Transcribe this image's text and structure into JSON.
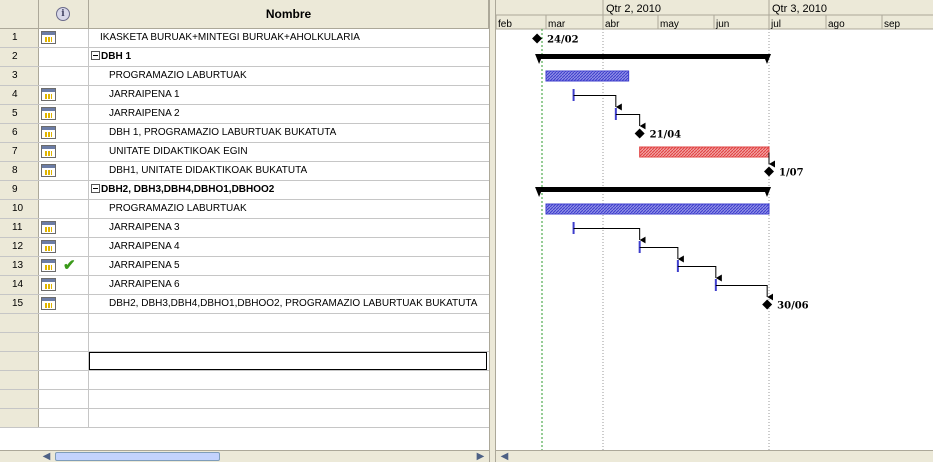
{
  "grid": {
    "header_name": "Nombre",
    "header_indicator_icon": "info-icon",
    "rows": [
      {
        "id": "1",
        "name": "IKASKETA BURUAK+MINTEGI BURUAK+AHOLKULARIA",
        "kind": "normal",
        "calendar_icon": true,
        "check_icon": false
      },
      {
        "id": "2",
        "name": "DBH 1",
        "kind": "summary",
        "calendar_icon": false,
        "check_icon": false
      },
      {
        "id": "3",
        "name": "PROGRAMAZIO LABURTUAK",
        "kind": "child",
        "calendar_icon": false,
        "check_icon": false
      },
      {
        "id": "4",
        "name": "JARRAIPENA 1",
        "kind": "child",
        "calendar_icon": true,
        "check_icon": false
      },
      {
        "id": "5",
        "name": "JARRAIPENA 2",
        "kind": "child",
        "calendar_icon": true,
        "check_icon": false
      },
      {
        "id": "6",
        "name": "DBH 1, PROGRAMAZIO LABURTUAK BUKATUTA",
        "kind": "child",
        "calendar_icon": true,
        "check_icon": false
      },
      {
        "id": "7",
        "name": "UNITATE DIDAKTIKOAK EGIN",
        "kind": "child",
        "calendar_icon": true,
        "check_icon": false
      },
      {
        "id": "8",
        "name": "DBH1, UNITATE DIDAKTIKOAK BUKATUTA",
        "kind": "child",
        "calendar_icon": true,
        "check_icon": false
      },
      {
        "id": "9",
        "name": "DBH2, DBH3,DBH4,DBHO1,DBHOO2",
        "kind": "summary",
        "calendar_icon": false,
        "check_icon": false
      },
      {
        "id": "10",
        "name": "PROGRAMAZIO LABURTUAK",
        "kind": "child",
        "calendar_icon": false,
        "check_icon": false
      },
      {
        "id": "11",
        "name": "JARRAIPENA 3",
        "kind": "child",
        "calendar_icon": true,
        "check_icon": false
      },
      {
        "id": "12",
        "name": "JARRAIPENA 4",
        "kind": "child",
        "calendar_icon": true,
        "check_icon": false
      },
      {
        "id": "13",
        "name": "JARRAIPENA 5",
        "kind": "child",
        "calendar_icon": true,
        "check_icon": true
      },
      {
        "id": "14",
        "name": "JARRAIPENA 6",
        "kind": "child",
        "calendar_icon": true,
        "check_icon": false
      },
      {
        "id": "15",
        "name": "DBH2, DBH3,DBH4,DBHO1,DBHOO2, PROGRAMAZIO LABURTUAK BUKATUTA",
        "kind": "child",
        "calendar_icon": true,
        "check_icon": false
      }
    ],
    "empty_row_count": 6
  },
  "gantt": {
    "quarters": [
      {
        "label": "Qtr 2, 2010"
      },
      {
        "label": "Qtr 3, 2010"
      }
    ],
    "months": [
      "feb",
      "mar",
      "abr",
      "may",
      "jun",
      "jul",
      "ago",
      "sep"
    ],
    "colors": {
      "task_bar": "#3d3dcc",
      "critical_bar": "#e04040",
      "summary_bar": "#000000",
      "link": "#000000",
      "today_line": "#2e9b2e"
    },
    "milestones": [
      {
        "row": 1,
        "date": "2010-02-24",
        "label": "24/02"
      },
      {
        "row": 6,
        "date": "2010-04-21",
        "label": "21/04"
      },
      {
        "row": 8,
        "date": "2010-07-01",
        "label": "1/07"
      },
      {
        "row": 15,
        "date": "2010-06-30",
        "label": "30/06"
      }
    ],
    "summaries": [
      {
        "row": 2,
        "start": "2010-02-24",
        "end": "2010-07-01"
      },
      {
        "row": 9,
        "start": "2010-02-24",
        "end": "2010-07-01"
      }
    ],
    "tasks": [
      {
        "row": 3,
        "start": "2010-03-01",
        "end": "2010-04-15",
        "style": "normal"
      },
      {
        "row": 7,
        "start": "2010-04-21",
        "end": "2010-07-01",
        "style": "critical"
      },
      {
        "row": 10,
        "start": "2010-03-01",
        "end": "2010-07-01",
        "style": "normal"
      }
    ],
    "short_tasks": [
      {
        "row": 4,
        "date": "2010-03-16"
      },
      {
        "row": 5,
        "date": "2010-04-08"
      },
      {
        "row": 11,
        "date": "2010-03-16"
      },
      {
        "row": 12,
        "date": "2010-04-21"
      },
      {
        "row": 13,
        "date": "2010-05-12"
      },
      {
        "row": 14,
        "date": "2010-06-02"
      }
    ],
    "links": [
      {
        "from_row": 4,
        "from_date": "2010-03-16",
        "to_row": 5,
        "to_date": "2010-04-08"
      },
      {
        "from_row": 5,
        "from_date": "2010-04-08",
        "to_row": 6,
        "to_date": "2010-04-21"
      },
      {
        "from_row": 7,
        "from_date": "2010-07-01",
        "to_row": 8,
        "to_date": "2010-07-01"
      },
      {
        "from_row": 11,
        "from_date": "2010-03-16",
        "to_row": 12,
        "to_date": "2010-04-21"
      },
      {
        "from_row": 12,
        "from_date": "2010-04-21",
        "to_row": 13,
        "to_date": "2010-05-12"
      },
      {
        "from_row": 13,
        "from_date": "2010-05-12",
        "to_row": 14,
        "to_date": "2010-06-02"
      },
      {
        "from_row": 14,
        "from_date": "2010-06-02",
        "to_row": 15,
        "to_date": "2010-06-30"
      }
    ]
  }
}
